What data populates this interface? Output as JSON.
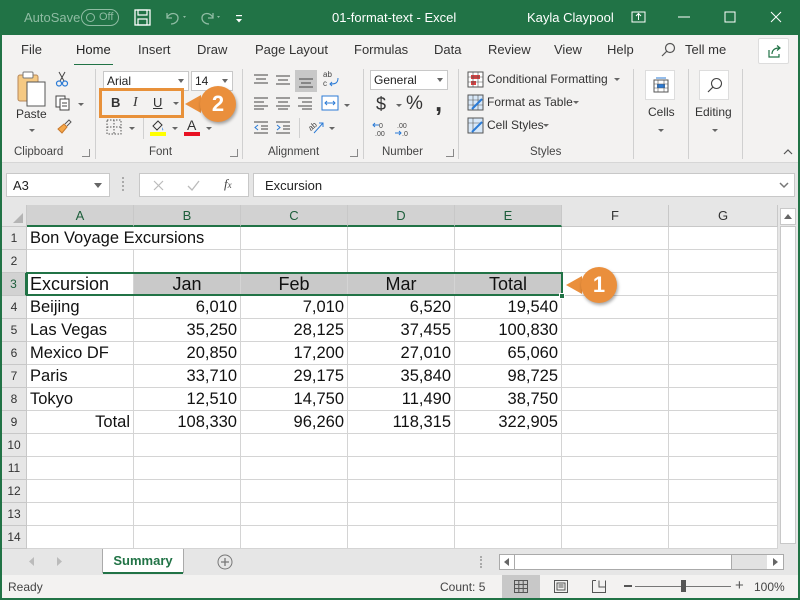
{
  "titlebar": {
    "autosave_label": "AutoSave",
    "autosave_state": "Off",
    "document_title": "01-format-text  -  Excel",
    "user_name": "Kayla Claypool"
  },
  "tabs": [
    {
      "label": "File"
    },
    {
      "label": "Home",
      "active": true
    },
    {
      "label": "Insert"
    },
    {
      "label": "Draw"
    },
    {
      "label": "Page Layout"
    },
    {
      "label": "Formulas"
    },
    {
      "label": "Data"
    },
    {
      "label": "Review"
    },
    {
      "label": "View"
    },
    {
      "label": "Help"
    }
  ],
  "tell_me": "Tell me",
  "ribbon": {
    "clipboard": {
      "label": "Clipboard",
      "paste": "Paste"
    },
    "font": {
      "label": "Font",
      "font_name": "Arial",
      "font_size": "14",
      "bold": "B",
      "italic": "I",
      "underline": "U"
    },
    "alignment": {
      "label": "Alignment"
    },
    "number": {
      "label": "Number",
      "format": "General",
      "currency": "$",
      "percent": "%",
      "comma": ","
    },
    "styles": {
      "label": "Styles",
      "conditional_formatting": "Conditional Formatting",
      "format_as_table": "Format as Table",
      "cell_styles": "Cell Styles"
    },
    "cells": {
      "label": "Cells"
    },
    "editing": {
      "label": "Editing"
    }
  },
  "callouts": {
    "one": "1",
    "two": "2"
  },
  "formula_bar": {
    "name_box": "A3",
    "formula": "Excursion"
  },
  "grid": {
    "columns": [
      "A",
      "B",
      "C",
      "D",
      "E",
      "F",
      "G"
    ],
    "rows": [
      "1",
      "2",
      "3",
      "4",
      "5",
      "6",
      "7",
      "8",
      "9",
      "10",
      "11",
      "12",
      "13",
      "14"
    ],
    "title": "Bon Voyage Excursions",
    "header": [
      "Excursion",
      "Jan",
      "Feb",
      "Mar",
      "Total"
    ],
    "data": [
      [
        "Beijing",
        "6,010",
        "7,010",
        "6,520",
        "19,540"
      ],
      [
        "Las Vegas",
        "35,250",
        "28,125",
        "37,455",
        "100,830"
      ],
      [
        "Mexico DF",
        "20,850",
        "17,200",
        "27,010",
        "65,060"
      ],
      [
        "Paris",
        "33,710",
        "29,175",
        "35,840",
        "98,725"
      ],
      [
        "Tokyo",
        "12,510",
        "14,750",
        "11,490",
        "38,750"
      ]
    ],
    "totals": [
      "Total",
      "108,330",
      "96,260",
      "118,315",
      "322,905"
    ]
  },
  "sheets": [
    {
      "label": "Summary",
      "active": true
    }
  ],
  "status": {
    "ready": "Ready",
    "count": "Count: 5",
    "zoom": "100%",
    "zoom_level": 1.0
  },
  "colors": {
    "brand": "#217346",
    "callout": "#ea8f3c",
    "header_fill": "#c9c9c9"
  }
}
